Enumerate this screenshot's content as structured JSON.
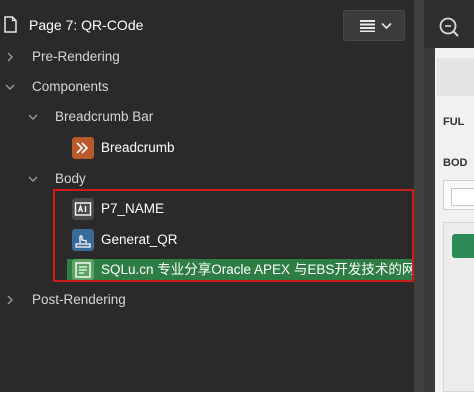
{
  "header": {
    "page_title": "Page 7: QR-COde",
    "menu_icon": "hamburger-menu-icon",
    "menu_chevron": "chevron-down-icon"
  },
  "tree": {
    "pre_rendering": "Pre-Rendering",
    "components": "Components",
    "breadcrumb_bar": "Breadcrumb Bar",
    "breadcrumb": "Breadcrumb",
    "body": "Body",
    "p7_name": "P7_NAME",
    "generat_qr": "Generat_QR",
    "selected_item": "SQLu.cn 专业分享Oracle APEX 与EBS开发技术的网站",
    "post_rendering": "Post-Rendering"
  },
  "right_panel": {
    "label_full": "FUL",
    "label_body": "BOD",
    "zoom_icon": "zoom-icon"
  },
  "colors": {
    "panel_bg": "#2a2a2a",
    "selected_bg": "#2e7d45",
    "highlight_border": "#cf1d1d",
    "breadcrumb_icon": "#b85a2c",
    "item_icon": "#4a4a4a",
    "button_icon": "#3a6a98",
    "text_region_icon": "#5aa363"
  }
}
